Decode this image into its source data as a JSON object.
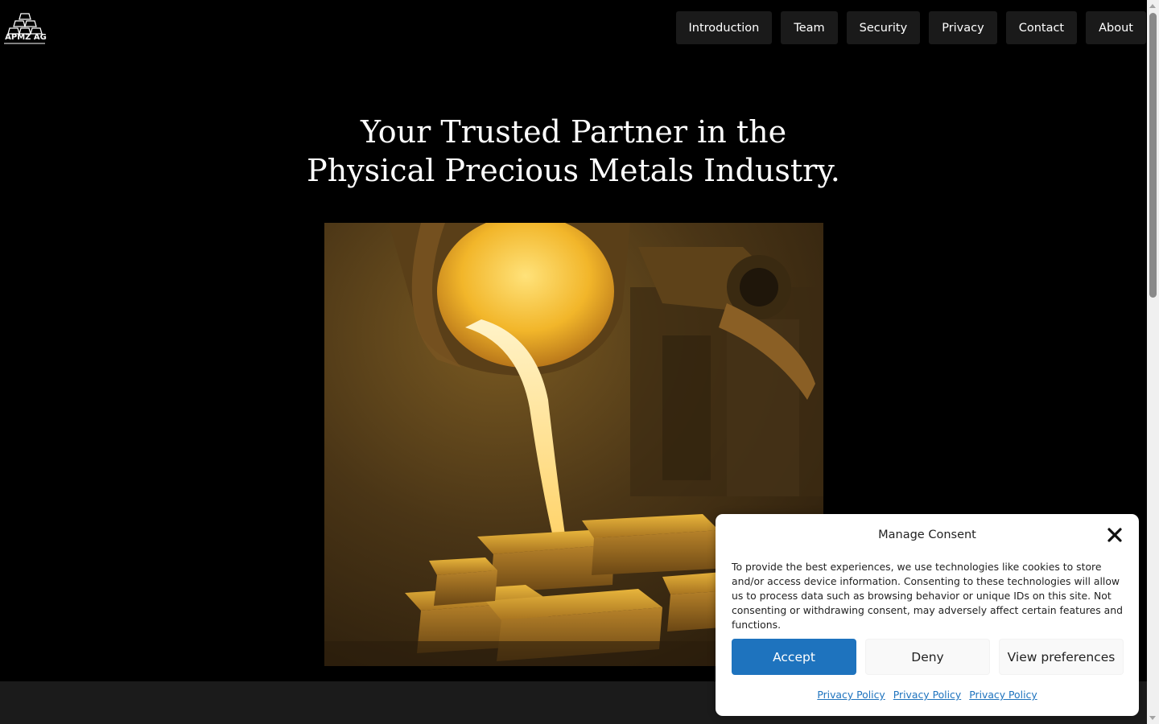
{
  "brand": {
    "logo_text": "APMZ AG"
  },
  "nav": {
    "items": [
      {
        "label": "Introduction"
      },
      {
        "label": "Team"
      },
      {
        "label": "Security"
      },
      {
        "label": "Privacy"
      },
      {
        "label": "Contact"
      },
      {
        "label": "About"
      }
    ]
  },
  "hero": {
    "title_line1": "Your Trusted Partner in the",
    "title_line2": "Physical Precious Metals Industry."
  },
  "consent": {
    "title": "Manage Consent",
    "body": "To provide the best experiences, we use technologies like cookies to store and/or access device information. Consenting to these technologies will allow us to process data such as browsing behavior or unique IDs on this site. Not consenting or withdrawing consent, may adversely affect certain features and functions.",
    "accept_label": "Accept",
    "deny_label": "Deny",
    "preferences_label": "View preferences",
    "links": [
      "Privacy Policy",
      "Privacy Policy",
      "Privacy Policy"
    ],
    "accent_color": "#1e73be"
  }
}
